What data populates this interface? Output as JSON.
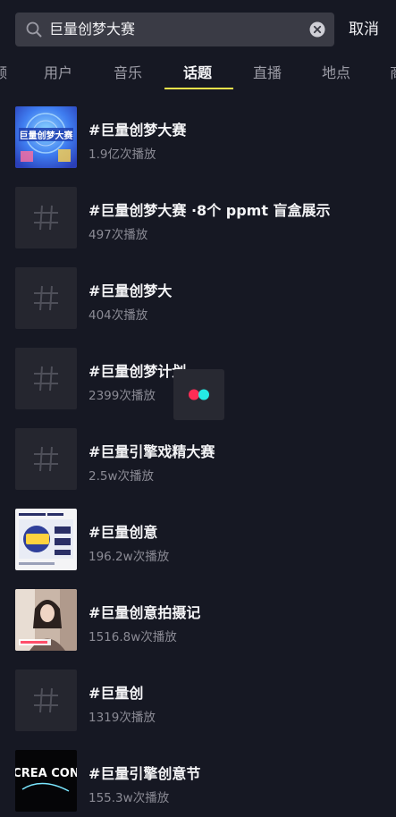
{
  "search": {
    "query": "巨量创梦大赛",
    "cancel_label": "取消"
  },
  "tabs": [
    {
      "label": "频"
    },
    {
      "label": "用户"
    },
    {
      "label": "音乐"
    },
    {
      "label": "话题"
    },
    {
      "label": "直播"
    },
    {
      "label": "地点"
    },
    {
      "label": "商"
    }
  ],
  "active_tab": "话题",
  "results": [
    {
      "title": "#巨量创梦大赛",
      "views": "1.9亿次播放",
      "thumb": "image"
    },
    {
      "title": "#巨量创梦大赛 ·8个 ppmt 盲盒展示",
      "views": "497次播放",
      "thumb": "hash-icon"
    },
    {
      "title": "#巨量创梦大",
      "views": "404次播放",
      "thumb": "hash-icon"
    },
    {
      "title": "#巨量创梦计划",
      "views": "2399次播放",
      "thumb": "hash-icon"
    },
    {
      "title": "#巨量引擎戏精大赛",
      "views": "2.5w次播放",
      "thumb": "hash-icon"
    },
    {
      "title": "#巨量创意",
      "views": "196.2w次播放",
      "thumb": "image"
    },
    {
      "title": "#巨量创意拍摄记",
      "views": "1516.8w次播放",
      "thumb": "image"
    },
    {
      "title": "#巨量创",
      "views": "1319次播放",
      "thumb": "hash-icon"
    },
    {
      "title": "#巨量引擎创意节",
      "views": "155.3w次播放",
      "thumb": "image"
    }
  ],
  "thumb_texts": {
    "first": "巨量创梦大赛",
    "ninth": "CREA CON"
  },
  "colors": {
    "background": "#161823",
    "tab_indicator": "#f2e34b",
    "badge_red": "#fe2c55",
    "badge_cyan": "#25f4ee"
  }
}
